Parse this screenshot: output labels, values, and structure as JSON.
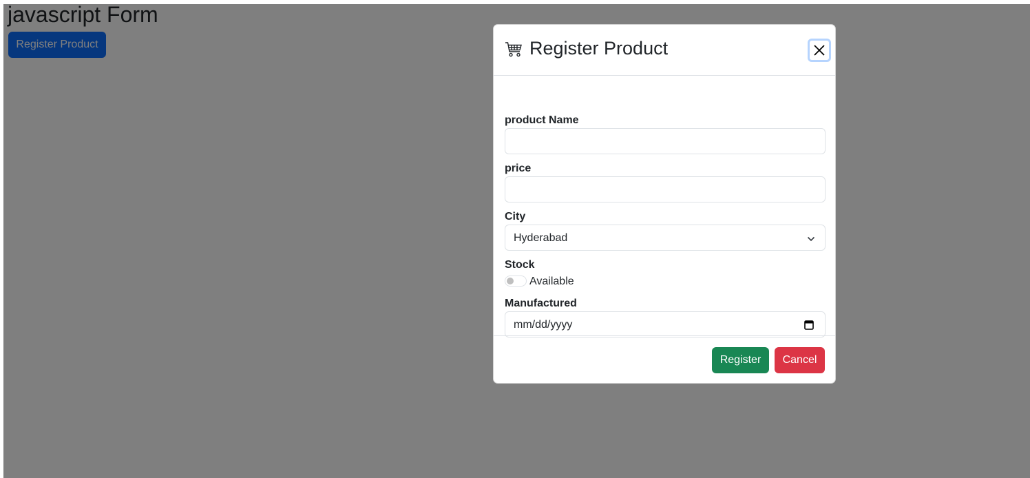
{
  "page": {
    "title": "javascript Form",
    "open_button_label": "Register Product"
  },
  "modal": {
    "icon": "cart-icon",
    "title": "Register Product",
    "close_icon": "close-icon",
    "fields": {
      "product_name": {
        "label": "product Name",
        "value": ""
      },
      "price": {
        "label": "price",
        "value": ""
      },
      "city": {
        "label": "City",
        "selected": "Hyderabad"
      },
      "stock": {
        "label": "Stock",
        "toggle_label": "Available",
        "checked": false
      },
      "manufactured": {
        "label": "Manufactured",
        "placeholder": "mm/dd/yyyy"
      }
    },
    "footer": {
      "register_label": "Register",
      "cancel_label": "Cancel"
    }
  },
  "colors": {
    "primary": "#0d6efd",
    "success": "#198754",
    "danger": "#dc3545",
    "backdrop": "#808080"
  }
}
